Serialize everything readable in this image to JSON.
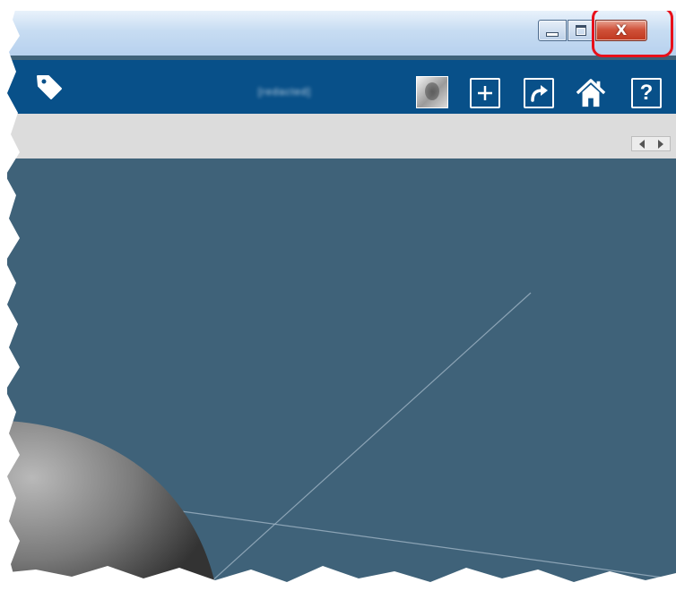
{
  "window": {
    "controls": {
      "minimize_icon": "minimize-icon",
      "maximize_icon": "maximize-icon",
      "close_label": "X"
    },
    "highlight_color": "#e8101a"
  },
  "toolbar": {
    "tag_icon": "tag-icon",
    "username": "[redacted]",
    "avatar_icon": "user-avatar",
    "add_icon": "add-icon",
    "share_icon": "share-icon",
    "home_icon": "home-icon",
    "help_label": "?"
  },
  "subbar": {
    "prev_icon": "arrow-left-icon",
    "next_icon": "arrow-right-icon"
  },
  "colors": {
    "toolbar_bg": "#085089",
    "canvas_bg": "#3f6279",
    "subbar_bg": "#dcdcdc",
    "close_button": "#cf5038"
  }
}
